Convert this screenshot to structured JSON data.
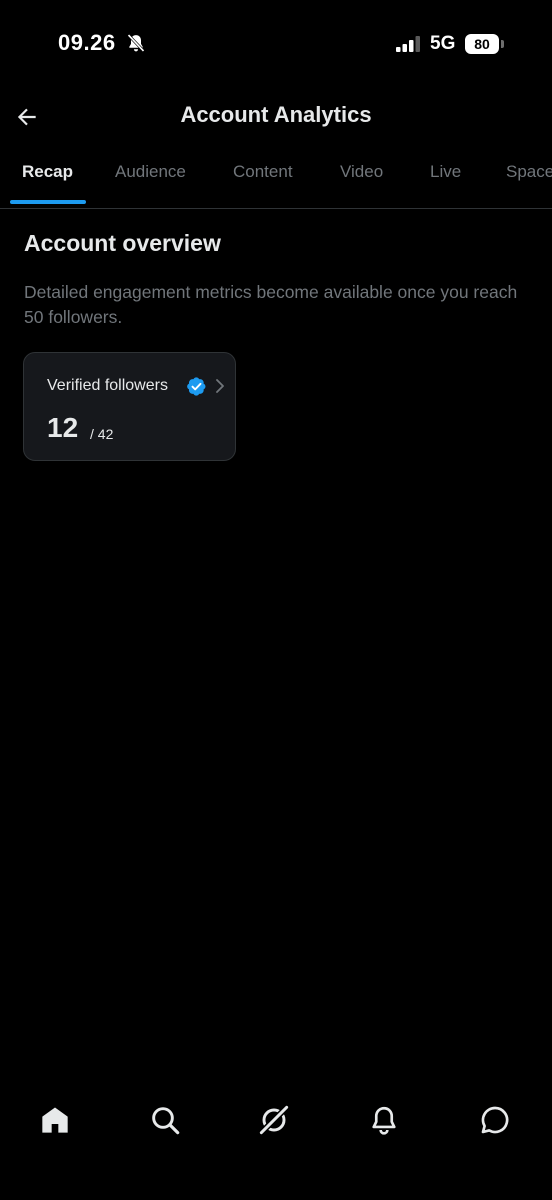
{
  "status_bar": {
    "time": "09.26",
    "network": "5G",
    "battery": "80",
    "icons": [
      "bell-muted-icon",
      "signal-icon",
      "battery-icon"
    ]
  },
  "header": {
    "title": "Account Analytics",
    "back_icon": "arrow-left-icon"
  },
  "tabs": [
    {
      "label": "Recap",
      "active": true
    },
    {
      "label": "Audience",
      "active": false
    },
    {
      "label": "Content",
      "active": false
    },
    {
      "label": "Video",
      "active": false
    },
    {
      "label": "Live",
      "active": false
    },
    {
      "label": "Spaces",
      "active": false
    }
  ],
  "overview": {
    "title": "Account overview",
    "description": "Detailed engagement metrics become available once you reach 50 followers."
  },
  "metric_card": {
    "label": "Verified followers",
    "value": "12",
    "total": "/ 42",
    "icons": [
      "verified-badge-icon",
      "chevron-right-icon"
    ]
  },
  "bottom_nav": {
    "items": [
      "home-icon",
      "search-icon",
      "grok-icon",
      "bell-icon",
      "messages-icon"
    ]
  },
  "colors": {
    "background": "#000000",
    "text_primary": "#e7e9ea",
    "text_secondary": "#71767b",
    "accent": "#1d9bf0",
    "card_bg": "#16181c",
    "border": "#2f3336"
  }
}
